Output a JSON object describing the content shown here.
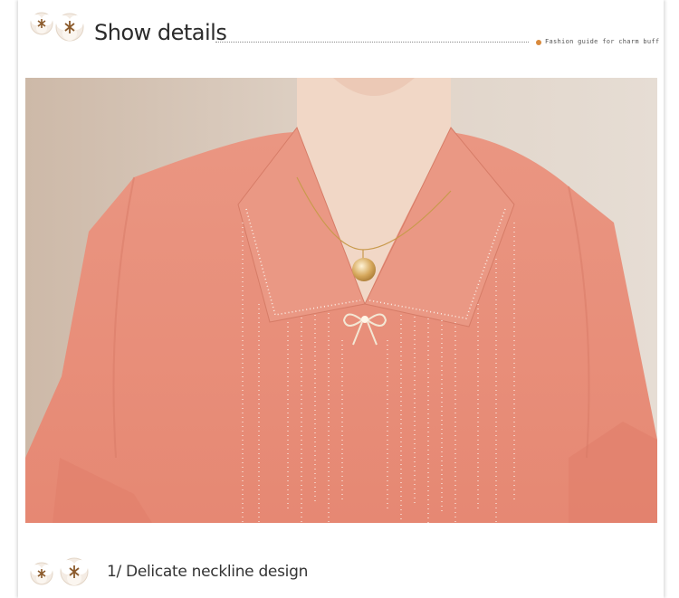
{
  "header": {
    "title": "Show details",
    "subtitle": "Fashion guide for charm buff",
    "flower_icon": "cotton-flower-icon"
  },
  "photo": {
    "subject": "product-photo",
    "colors": {
      "garment": "#e8907a",
      "background": "#d9cbbd",
      "skin": "#f1d7c6",
      "pendant": "#d6a85c"
    }
  },
  "footer": {
    "caption": "1/ Delicate neckline design",
    "flower_icon": "cotton-flower-icon"
  },
  "colors": {
    "bullet": "#d98a3c",
    "text": "#2b2b2b"
  }
}
